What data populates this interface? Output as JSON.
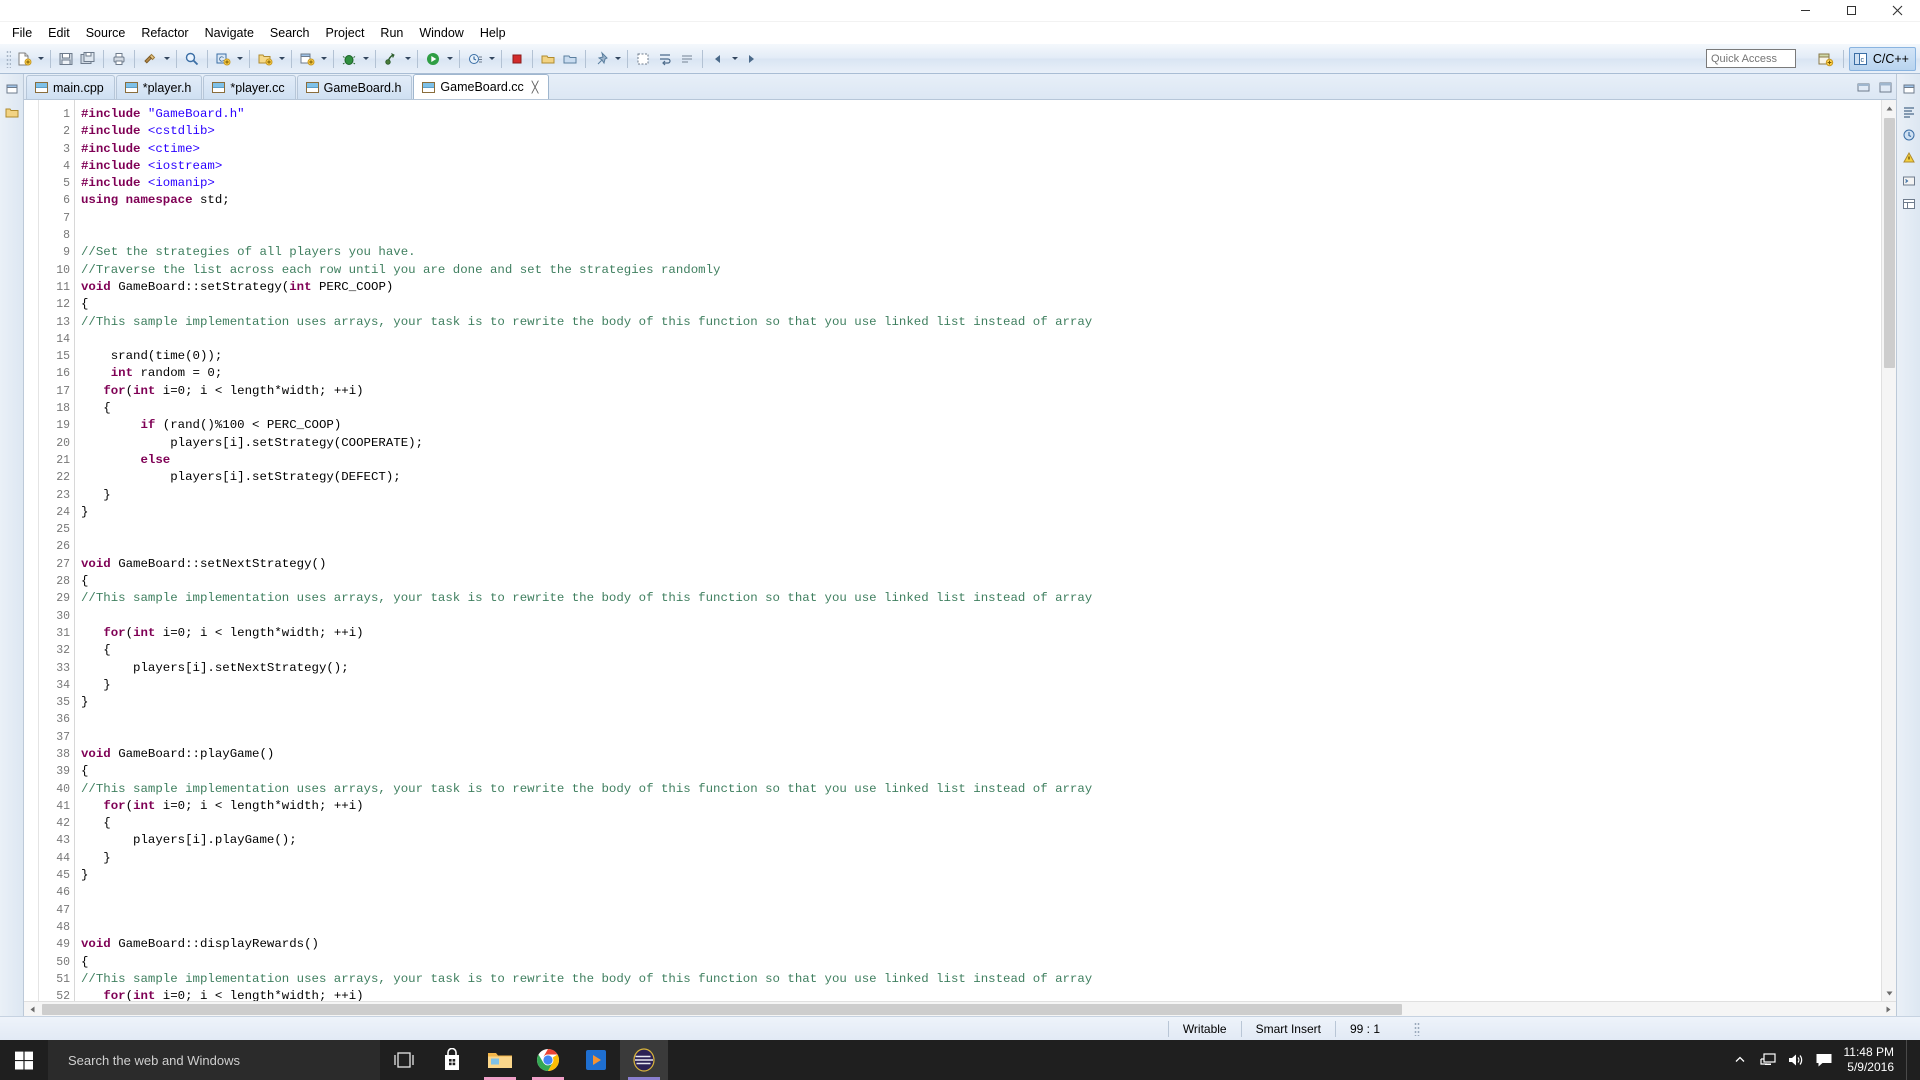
{
  "window": {
    "minimize_label": "Minimize",
    "maximize_label": "Maximize",
    "close_label": "Close"
  },
  "menubar": {
    "items": [
      {
        "label": "File"
      },
      {
        "label": "Edit"
      },
      {
        "label": "Source"
      },
      {
        "label": "Refactor"
      },
      {
        "label": "Navigate"
      },
      {
        "label": "Search"
      },
      {
        "label": "Project"
      },
      {
        "label": "Run"
      },
      {
        "label": "Window"
      },
      {
        "label": "Help"
      }
    ]
  },
  "toolbar": {
    "quick_access_placeholder": "Quick Access",
    "perspective_label": "C/C++",
    "open_perspective_tooltip": "Open Perspective"
  },
  "tabs": [
    {
      "label": "main.cpp",
      "active": false,
      "dirty": false
    },
    {
      "label": "*player.h",
      "active": false,
      "dirty": true
    },
    {
      "label": "*player.cc",
      "active": false,
      "dirty": true
    },
    {
      "label": "GameBoard.h",
      "active": false,
      "dirty": false
    },
    {
      "label": "GameBoard.cc",
      "active": true,
      "dirty": false
    }
  ],
  "editor": {
    "first_line": 1,
    "last_line": 52,
    "lines": [
      {
        "n": 1,
        "tokens": [
          {
            "t": "pre",
            "v": "#include "
          },
          {
            "t": "str",
            "v": "\"GameBoard.h\""
          }
        ]
      },
      {
        "n": 2,
        "tokens": [
          {
            "t": "pre",
            "v": "#include "
          },
          {
            "t": "str",
            "v": "<cstdlib>"
          }
        ]
      },
      {
        "n": 3,
        "tokens": [
          {
            "t": "pre",
            "v": "#include "
          },
          {
            "t": "str",
            "v": "<ctime>"
          }
        ]
      },
      {
        "n": 4,
        "tokens": [
          {
            "t": "pre",
            "v": "#include "
          },
          {
            "t": "str",
            "v": "<iostream>"
          }
        ]
      },
      {
        "n": 5,
        "tokens": [
          {
            "t": "pre",
            "v": "#include "
          },
          {
            "t": "str",
            "v": "<iomanip>"
          }
        ]
      },
      {
        "n": 6,
        "tokens": [
          {
            "t": "kw",
            "v": "using namespace "
          },
          {
            "t": "plain",
            "v": "std;"
          }
        ]
      },
      {
        "n": 7,
        "tokens": []
      },
      {
        "n": 8,
        "tokens": []
      },
      {
        "n": 9,
        "tokens": [
          {
            "t": "cmt",
            "v": "//Set the strategies of all players you have."
          }
        ]
      },
      {
        "n": 10,
        "tokens": [
          {
            "t": "cmt",
            "v": "//Traverse the list across each row until you are done and set the strategies randomly"
          }
        ]
      },
      {
        "n": 11,
        "tokens": [
          {
            "t": "kw",
            "v": "void "
          },
          {
            "t": "plain",
            "v": "GameBoard::setStrategy("
          },
          {
            "t": "kw",
            "v": "int"
          },
          {
            "t": "plain",
            "v": " PERC_COOP)"
          }
        ]
      },
      {
        "n": 12,
        "tokens": [
          {
            "t": "plain",
            "v": "{"
          }
        ]
      },
      {
        "n": 13,
        "tokens": [
          {
            "t": "cmt",
            "v": "//This sample implementation uses arrays, your task is to rewrite the body of this function so that you use linked list instead of array"
          }
        ]
      },
      {
        "n": 14,
        "tokens": []
      },
      {
        "n": 15,
        "tokens": [
          {
            "t": "plain",
            "v": "    srand(time(0));"
          }
        ]
      },
      {
        "n": 16,
        "tokens": [
          {
            "t": "plain",
            "v": "    "
          },
          {
            "t": "kw",
            "v": "int"
          },
          {
            "t": "plain",
            "v": " random = 0;"
          }
        ]
      },
      {
        "n": 17,
        "tokens": [
          {
            "t": "plain",
            "v": "   "
          },
          {
            "t": "kw",
            "v": "for"
          },
          {
            "t": "plain",
            "v": "("
          },
          {
            "t": "kw",
            "v": "int"
          },
          {
            "t": "plain",
            "v": " i=0; i < length*width; ++i)"
          }
        ]
      },
      {
        "n": 18,
        "tokens": [
          {
            "t": "plain",
            "v": "   {"
          }
        ]
      },
      {
        "n": 19,
        "tokens": [
          {
            "t": "plain",
            "v": "        "
          },
          {
            "t": "kw",
            "v": "if"
          },
          {
            "t": "plain",
            "v": " (rand()%100 < PERC_COOP)"
          }
        ]
      },
      {
        "n": 20,
        "tokens": [
          {
            "t": "plain",
            "v": "            players[i].setStrategy(COOPERATE);"
          }
        ]
      },
      {
        "n": 21,
        "tokens": [
          {
            "t": "plain",
            "v": "        "
          },
          {
            "t": "kw",
            "v": "else"
          }
        ]
      },
      {
        "n": 22,
        "tokens": [
          {
            "t": "plain",
            "v": "            players[i].setStrategy(DEFECT);"
          }
        ]
      },
      {
        "n": 23,
        "tokens": [
          {
            "t": "plain",
            "v": "   }"
          }
        ]
      },
      {
        "n": 24,
        "tokens": [
          {
            "t": "plain",
            "v": "}"
          }
        ]
      },
      {
        "n": 25,
        "tokens": []
      },
      {
        "n": 26,
        "tokens": []
      },
      {
        "n": 27,
        "tokens": [
          {
            "t": "kw",
            "v": "void "
          },
          {
            "t": "plain",
            "v": "GameBoard::setNextStrategy()"
          }
        ]
      },
      {
        "n": 28,
        "tokens": [
          {
            "t": "plain",
            "v": "{"
          }
        ]
      },
      {
        "n": 29,
        "tokens": [
          {
            "t": "cmt",
            "v": "//This sample implementation uses arrays, your task is to rewrite the body of this function so that you use linked list instead of array"
          }
        ]
      },
      {
        "n": 30,
        "tokens": []
      },
      {
        "n": 31,
        "tokens": [
          {
            "t": "plain",
            "v": "   "
          },
          {
            "t": "kw",
            "v": "for"
          },
          {
            "t": "plain",
            "v": "("
          },
          {
            "t": "kw",
            "v": "int"
          },
          {
            "t": "plain",
            "v": " i=0; i < length*width; ++i)"
          }
        ]
      },
      {
        "n": 32,
        "tokens": [
          {
            "t": "plain",
            "v": "   {"
          }
        ]
      },
      {
        "n": 33,
        "tokens": [
          {
            "t": "plain",
            "v": "       players[i].setNextStrategy();"
          }
        ]
      },
      {
        "n": 34,
        "tokens": [
          {
            "t": "plain",
            "v": "   }"
          }
        ]
      },
      {
        "n": 35,
        "tokens": [
          {
            "t": "plain",
            "v": "}"
          }
        ]
      },
      {
        "n": 36,
        "tokens": []
      },
      {
        "n": 37,
        "tokens": []
      },
      {
        "n": 38,
        "tokens": [
          {
            "t": "kw",
            "v": "void "
          },
          {
            "t": "plain",
            "v": "GameBoard::playGame()"
          }
        ]
      },
      {
        "n": 39,
        "tokens": [
          {
            "t": "plain",
            "v": "{"
          }
        ]
      },
      {
        "n": 40,
        "tokens": [
          {
            "t": "cmt",
            "v": "//This sample implementation uses arrays, your task is to rewrite the body of this function so that you use linked list instead of array"
          }
        ]
      },
      {
        "n": 41,
        "tokens": [
          {
            "t": "plain",
            "v": "   "
          },
          {
            "t": "kw",
            "v": "for"
          },
          {
            "t": "plain",
            "v": "("
          },
          {
            "t": "kw",
            "v": "int"
          },
          {
            "t": "plain",
            "v": " i=0; i < length*width; ++i)"
          }
        ]
      },
      {
        "n": 42,
        "tokens": [
          {
            "t": "plain",
            "v": "   {"
          }
        ]
      },
      {
        "n": 43,
        "tokens": [
          {
            "t": "plain",
            "v": "       players[i].playGame();"
          }
        ]
      },
      {
        "n": 44,
        "tokens": [
          {
            "t": "plain",
            "v": "   }"
          }
        ]
      },
      {
        "n": 45,
        "tokens": [
          {
            "t": "plain",
            "v": "}"
          }
        ]
      },
      {
        "n": 46,
        "tokens": []
      },
      {
        "n": 47,
        "tokens": []
      },
      {
        "n": 48,
        "tokens": []
      },
      {
        "n": 49,
        "tokens": [
          {
            "t": "kw",
            "v": "void "
          },
          {
            "t": "plain",
            "v": "GameBoard::displayRewards()"
          }
        ]
      },
      {
        "n": 50,
        "tokens": [
          {
            "t": "plain",
            "v": "{"
          }
        ]
      },
      {
        "n": 51,
        "tokens": [
          {
            "t": "cmt",
            "v": "//This sample implementation uses arrays, your task is to rewrite the body of this function so that you use linked list instead of array"
          }
        ]
      },
      {
        "n": 52,
        "tokens": [
          {
            "t": "plain",
            "v": "   "
          },
          {
            "t": "kw",
            "v": "for"
          },
          {
            "t": "plain",
            "v": "("
          },
          {
            "t": "kw",
            "v": "int"
          },
          {
            "t": "plain",
            "v": " i=0; i < length*width; ++i)"
          }
        ]
      }
    ]
  },
  "statusbar": {
    "writable": "Writable",
    "insert_mode": "Smart Insert",
    "cursor_position": "99 : 1"
  },
  "taskbar": {
    "search_placeholder": "Search the web and Windows",
    "time": "11:48 PM",
    "date": "5/9/2016"
  },
  "colors": {
    "keyword": "#7f0055",
    "string": "#2a00ff",
    "comment": "#3f7f5f",
    "accent": "#b9d4ef",
    "taskbar_bg": "#1f1f1f"
  }
}
